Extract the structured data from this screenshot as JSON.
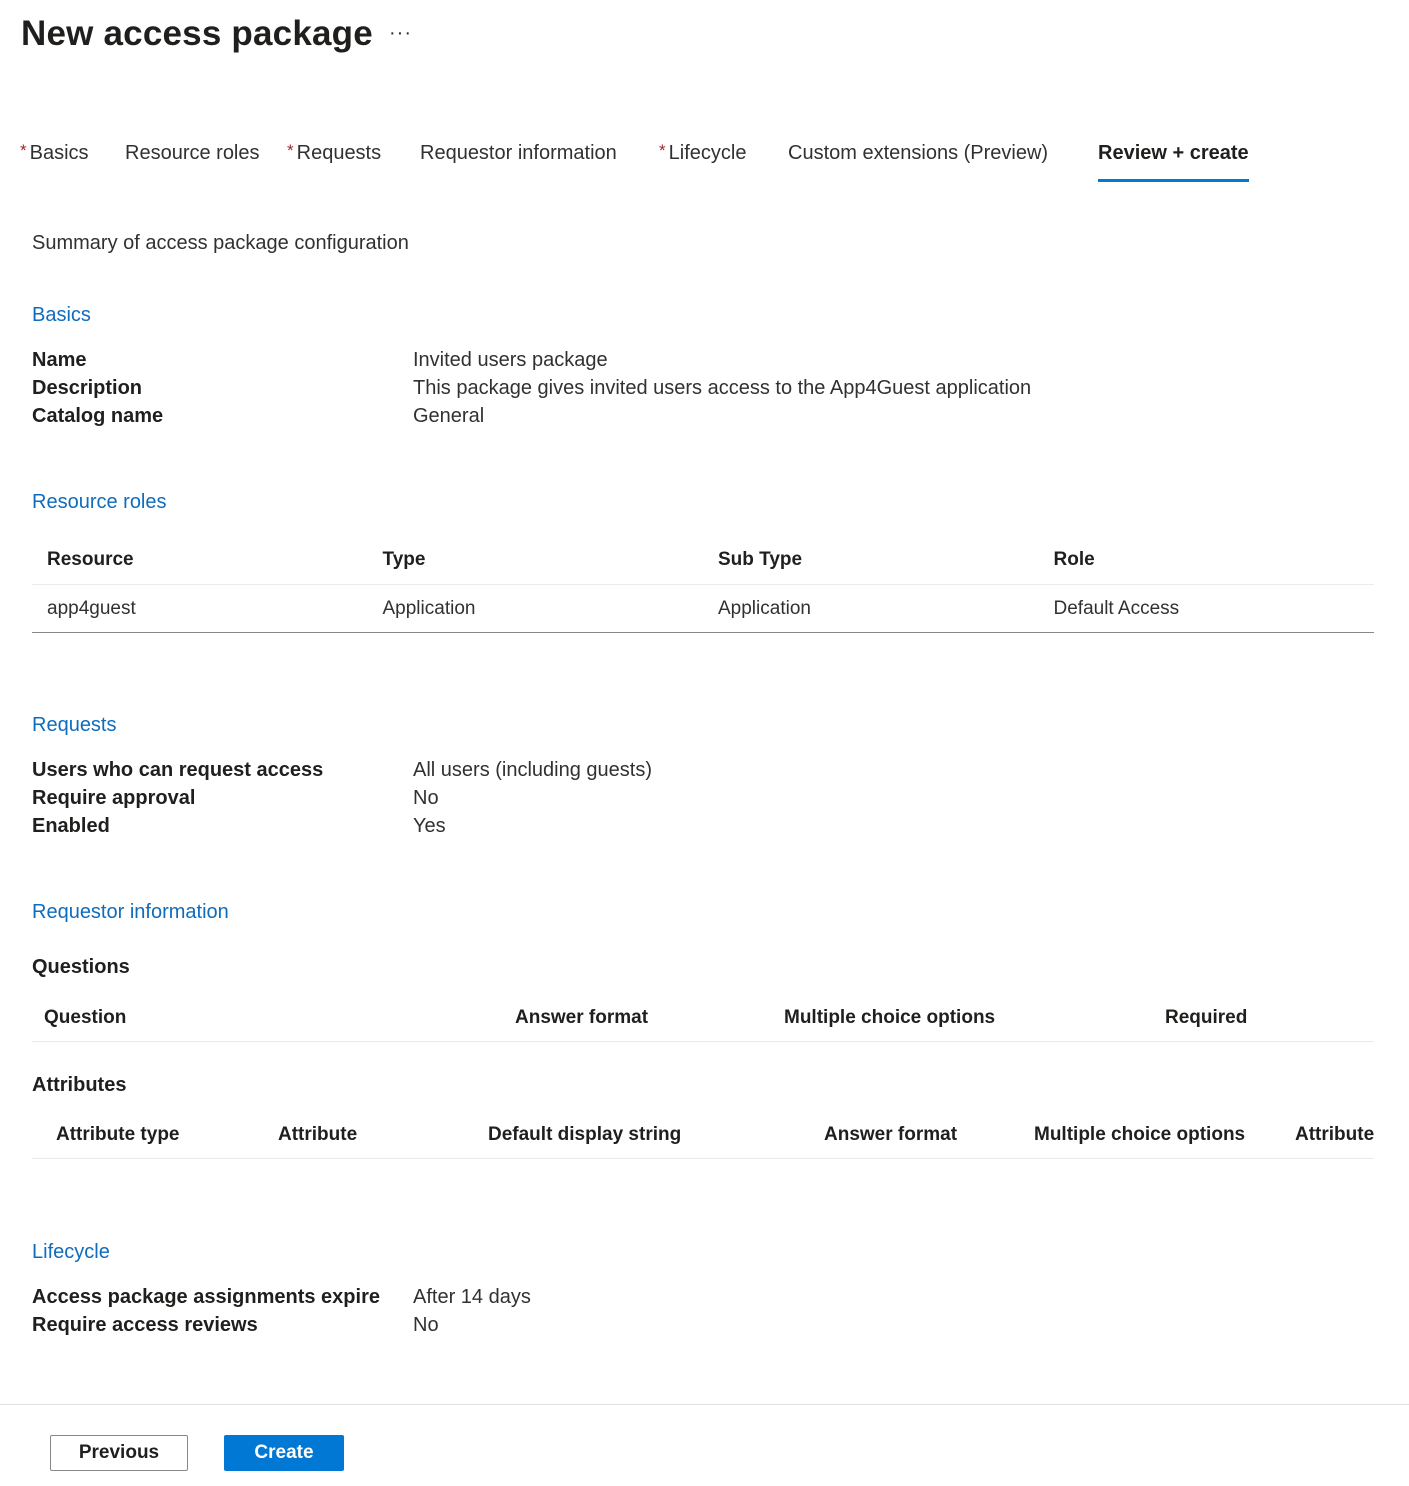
{
  "header": {
    "title": "New access package",
    "more_label": "···"
  },
  "tabs": [
    {
      "label": "Basics",
      "required": true
    },
    {
      "label": "Resource roles",
      "required": false
    },
    {
      "label": "Requests",
      "required": true
    },
    {
      "label": "Requestor information",
      "required": false
    },
    {
      "label": "Lifecycle",
      "required": true
    },
    {
      "label": "Custom extensions (Preview)",
      "required": false
    },
    {
      "label": "Review + create",
      "required": false,
      "active": true
    }
  ],
  "required_marker": "*",
  "summary": "Summary of access package configuration",
  "basics": {
    "title": "Basics",
    "rows": [
      {
        "key": "Name",
        "value": "Invited users package"
      },
      {
        "key": "Description",
        "value": "This package gives invited users access to the App4Guest application"
      },
      {
        "key": "Catalog name",
        "value": "General"
      }
    ]
  },
  "resource_roles": {
    "title": "Resource roles",
    "columns": [
      "Resource",
      "Type",
      "Sub Type",
      "Role"
    ],
    "rows": [
      [
        "app4guest",
        "Application",
        "Application",
        "Default Access"
      ]
    ]
  },
  "requests": {
    "title": "Requests",
    "rows": [
      {
        "key": "Users who can request access",
        "value": "All users (including guests)"
      },
      {
        "key": "Require approval",
        "value": "No"
      },
      {
        "key": "Enabled",
        "value": "Yes"
      }
    ]
  },
  "requestor_info": {
    "title": "Requestor information",
    "questions_label": "Questions",
    "question_columns": [
      "Question",
      "Answer format",
      "Multiple choice options",
      "Required"
    ],
    "attributes_label": "Attributes",
    "attribute_columns": [
      "Attribute type",
      "Attribute",
      "Default display string",
      "Answer format",
      "Multiple choice options",
      "Attribute"
    ]
  },
  "lifecycle": {
    "title": "Lifecycle",
    "rows": [
      {
        "key": "Access package assignments expire",
        "value": "After 14 days"
      },
      {
        "key": "Require access reviews",
        "value": "No"
      }
    ]
  },
  "footer": {
    "previous_label": "Previous",
    "create_label": "Create"
  },
  "colors": {
    "accent": "#0078d4",
    "link": "#0f6cbd",
    "required": "#a4262c"
  }
}
